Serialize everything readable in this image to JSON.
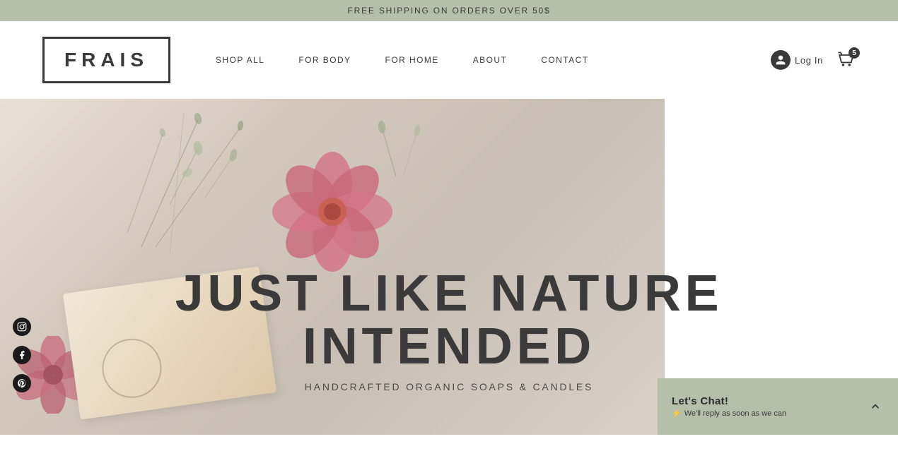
{
  "banner": {
    "text": "FREE SHIPPING ON ORDERS OVER 50$"
  },
  "header": {
    "logo": "FRAIS",
    "nav": [
      {
        "label": "SHOP ALL",
        "id": "shop-all"
      },
      {
        "label": "FOR BODY",
        "id": "for-body"
      },
      {
        "label": "FOR HOME",
        "id": "for-home"
      },
      {
        "label": "ABOUT",
        "id": "about"
      },
      {
        "label": "CONTACT",
        "id": "contact"
      }
    ],
    "login_label": "Log In",
    "cart_count": "5"
  },
  "social": [
    {
      "id": "instagram",
      "label": "Instagram"
    },
    {
      "id": "facebook",
      "label": "Facebook"
    },
    {
      "id": "pinterest",
      "label": "Pinterest"
    }
  ],
  "hero": {
    "headline_line1": "JUST LIKE NATURE",
    "headline_line2": "INTENDED",
    "subtitle": "HANDCRAFTED ORGANIC SOAPS & CANDLES"
  },
  "chat": {
    "title": "Let's Chat!",
    "subtitle": "We'll reply as soon as we can",
    "lightning_icon": "⚡"
  }
}
